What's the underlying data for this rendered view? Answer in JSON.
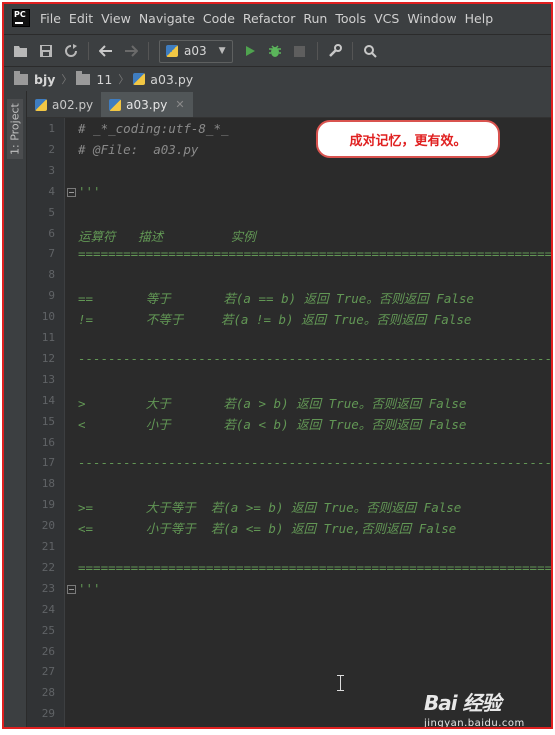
{
  "menubar": {
    "logo": "PC",
    "items": [
      "File",
      "Edit",
      "View",
      "Navigate",
      "Code",
      "Refactor",
      "Run",
      "Tools",
      "VCS",
      "Window",
      "Help"
    ]
  },
  "toolbar": {
    "run_config": "a03",
    "icons": [
      "open-icon",
      "save-icon",
      "sync-icon",
      "back-icon",
      "forward-icon",
      "run-icon",
      "debug-icon",
      "stop-icon",
      "wrench-icon",
      "search-icon"
    ]
  },
  "breadcrumb": {
    "project": "bjy",
    "folder": "11",
    "file": "a03.py"
  },
  "sidebar": {
    "project_tab": "1: Project"
  },
  "tabs": [
    {
      "label": "a02.py",
      "active": false
    },
    {
      "label": "a03.py",
      "active": true
    }
  ],
  "callout": "成对记忆，更有效。",
  "code": {
    "lines": [
      {
        "n": "1",
        "text": "# _*_coding:utf-8_*_",
        "kind": "cmt"
      },
      {
        "n": "2",
        "text": "# @File:  a03.py",
        "kind": "cmt"
      },
      {
        "n": "3",
        "text": "",
        "kind": "doc"
      },
      {
        "n": "4",
        "text": "'''",
        "kind": "doc"
      },
      {
        "n": "5",
        "text": "",
        "kind": "doc"
      },
      {
        "n": "6",
        "text": "运算符   描述         实例",
        "kind": "doc"
      },
      {
        "n": "7",
        "text": "====================================================================",
        "kind": "doc"
      },
      {
        "n": "8",
        "text": "",
        "kind": "doc"
      },
      {
        "n": "9",
        "text": "==       等于       若(a == b) 返回 True。否则返回 False",
        "kind": "doc"
      },
      {
        "n": "10",
        "text": "!=       不等于     若(a != b) 返回 True。否则返回 False",
        "kind": "doc"
      },
      {
        "n": "11",
        "text": "",
        "kind": "doc"
      },
      {
        "n": "12",
        "text": "--------------------------------------------------------------------",
        "kind": "doc"
      },
      {
        "n": "13",
        "text": "",
        "kind": "doc"
      },
      {
        "n": "14",
        "text": ">        大于       若(a > b) 返回 True。否则返回 False",
        "kind": "doc"
      },
      {
        "n": "15",
        "text": "<        小于       若(a < b) 返回 True。否则返回 False",
        "kind": "doc"
      },
      {
        "n": "16",
        "text": "",
        "kind": "doc"
      },
      {
        "n": "17",
        "text": "--------------------------------------------------------------------",
        "kind": "doc"
      },
      {
        "n": "18",
        "text": "",
        "kind": "doc"
      },
      {
        "n": "19",
        "text": ">=       大于等于  若(a >= b) 返回 True。否则返回 False",
        "kind": "doc"
      },
      {
        "n": "20",
        "text": "<=       小于等于  若(a <= b) 返回 True,否则返回 False",
        "kind": "doc"
      },
      {
        "n": "21",
        "text": "",
        "kind": "doc"
      },
      {
        "n": "22",
        "text": "====================================================================",
        "kind": "doc"
      },
      {
        "n": "23",
        "text": "'''",
        "kind": "doc"
      },
      {
        "n": "24",
        "text": "",
        "kind": "doc"
      },
      {
        "n": "25",
        "text": "",
        "kind": "doc"
      },
      {
        "n": "26",
        "text": "",
        "kind": "doc"
      },
      {
        "n": "27",
        "text": "",
        "kind": "doc"
      },
      {
        "n": "28",
        "text": "",
        "kind": "doc"
      },
      {
        "n": "29",
        "text": "",
        "kind": "doc"
      }
    ]
  },
  "watermark": {
    "top": "Bai 经验",
    "bottom": "jingyan.baidu.com"
  }
}
